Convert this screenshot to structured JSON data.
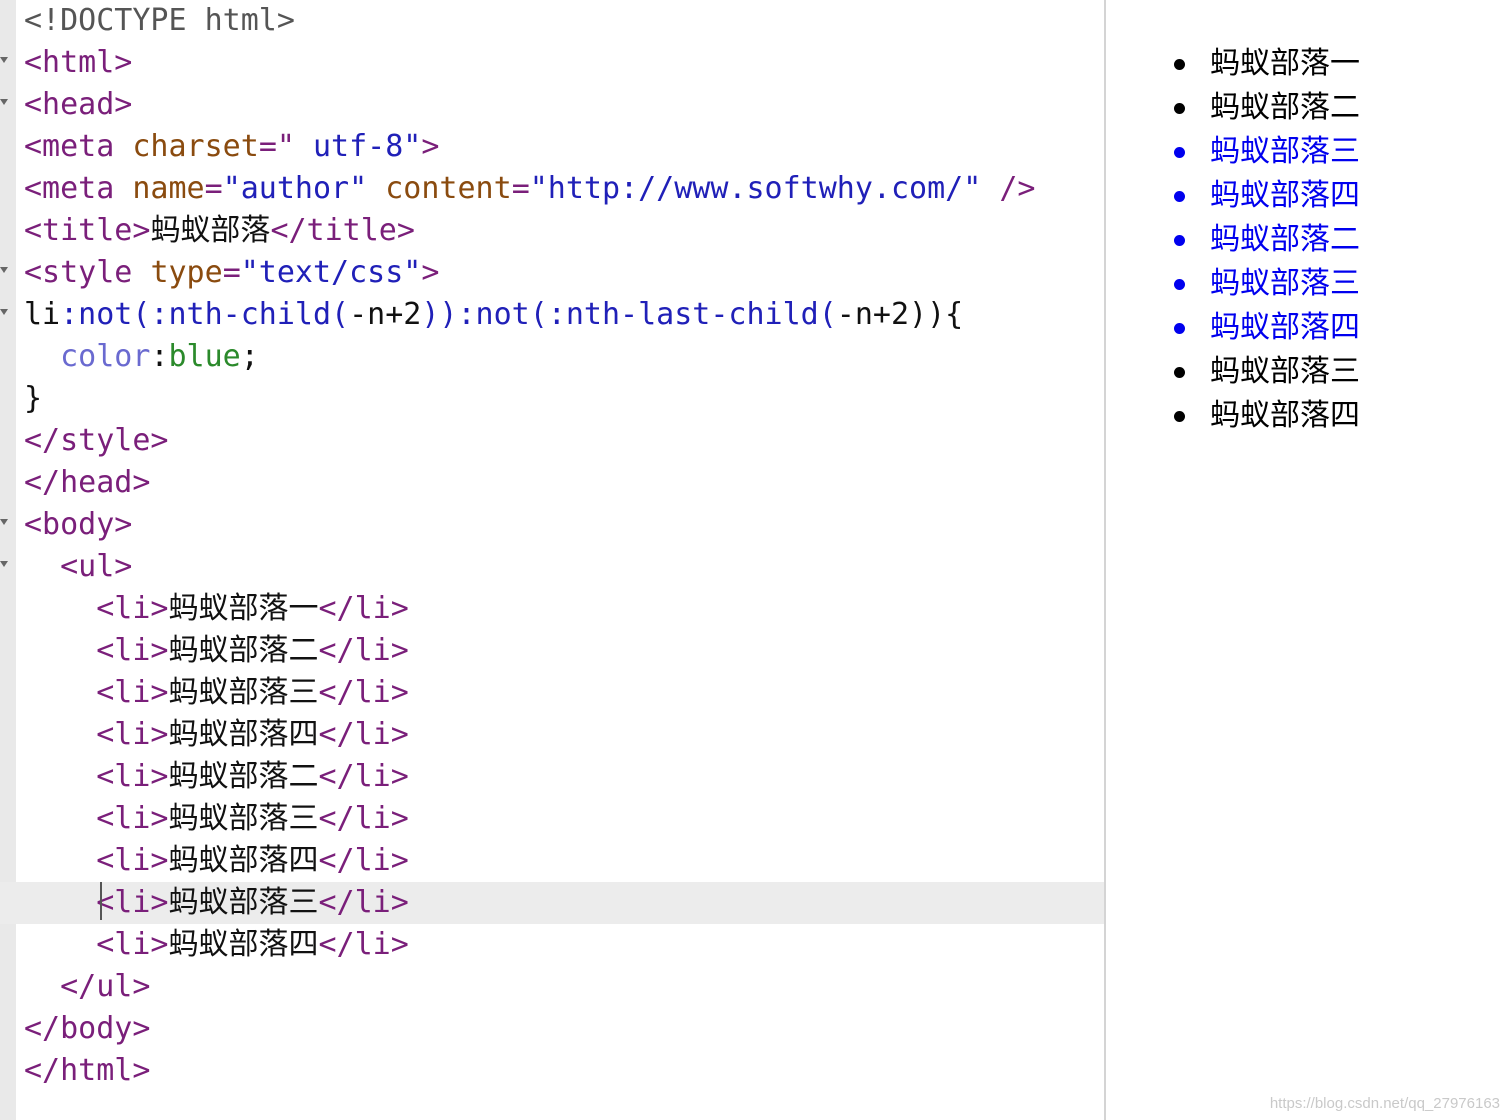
{
  "editor": {
    "lines": [
      [
        {
          "t": "<!DOCTYPE html>",
          "c": "doc"
        }
      ],
      [
        {
          "t": "<html>",
          "c": "tag"
        }
      ],
      [
        {
          "t": "<head>",
          "c": "tag"
        }
      ],
      [
        {
          "t": "<meta ",
          "c": "tag"
        },
        {
          "t": "charset",
          "c": "attr"
        },
        {
          "t": "=\" ",
          "c": "tag"
        },
        {
          "t": "utf-8\"",
          "c": "str"
        },
        {
          "t": ">",
          "c": "tag"
        }
      ],
      [
        {
          "t": "<meta ",
          "c": "tag"
        },
        {
          "t": "name",
          "c": "attr"
        },
        {
          "t": "=",
          "c": "tag"
        },
        {
          "t": "\"author\" ",
          "c": "str"
        },
        {
          "t": "content",
          "c": "attr"
        },
        {
          "t": "=",
          "c": "tag"
        },
        {
          "t": "\"http://www.softwhy.com/\"",
          "c": "str"
        },
        {
          "t": " />",
          "c": "tag"
        }
      ],
      [
        {
          "t": "<title>",
          "c": "tag"
        },
        {
          "t": "蚂蚁部落",
          "c": "text"
        },
        {
          "t": "</title>",
          "c": "tag"
        }
      ],
      [
        {
          "t": "<style ",
          "c": "tag"
        },
        {
          "t": "type",
          "c": "attr"
        },
        {
          "t": "=",
          "c": "tag"
        },
        {
          "t": "\"text/css\"",
          "c": "str"
        },
        {
          "t": ">",
          "c": "tag"
        }
      ],
      [
        {
          "t": "li",
          "c": "text"
        },
        {
          "t": ":not(:nth-child(",
          "c": "pseudo"
        },
        {
          "t": "-n+2",
          "c": "text"
        },
        {
          "t": ")):not(:nth-last-child(",
          "c": "pseudo"
        },
        {
          "t": "-n+2",
          "c": "text"
        },
        {
          "t": ")){",
          "c": "text"
        }
      ],
      [
        {
          "t": "  ",
          "c": "text"
        },
        {
          "t": "color",
          "c": "prop"
        },
        {
          "t": ":",
          "c": "text"
        },
        {
          "t": "blue",
          "c": "val"
        },
        {
          "t": ";",
          "c": "text"
        }
      ],
      [
        {
          "t": "}",
          "c": "text"
        }
      ],
      [
        {
          "t": "</style>",
          "c": "tag"
        }
      ],
      [
        {
          "t": "</head>",
          "c": "tag"
        }
      ],
      [
        {
          "t": "<body>",
          "c": "tag"
        }
      ],
      [
        {
          "t": "  ",
          "c": "text"
        },
        {
          "t": "<ul>",
          "c": "tag"
        }
      ],
      [
        {
          "t": "    ",
          "c": "text"
        },
        {
          "t": "<li>",
          "c": "tag"
        },
        {
          "t": "蚂蚁部落一",
          "c": "text"
        },
        {
          "t": "</li>",
          "c": "tag"
        }
      ],
      [
        {
          "t": "    ",
          "c": "text"
        },
        {
          "t": "<li>",
          "c": "tag"
        },
        {
          "t": "蚂蚁部落二",
          "c": "text"
        },
        {
          "t": "</li>",
          "c": "tag"
        }
      ],
      [
        {
          "t": "    ",
          "c": "text"
        },
        {
          "t": "<li>",
          "c": "tag"
        },
        {
          "t": "蚂蚁部落三",
          "c": "text"
        },
        {
          "t": "</li>",
          "c": "tag"
        }
      ],
      [
        {
          "t": "    ",
          "c": "text"
        },
        {
          "t": "<li>",
          "c": "tag"
        },
        {
          "t": "蚂蚁部落四",
          "c": "text"
        },
        {
          "t": "</li>",
          "c": "tag"
        }
      ],
      [
        {
          "t": "    ",
          "c": "text"
        },
        {
          "t": "<li>",
          "c": "tag"
        },
        {
          "t": "蚂蚁部落二",
          "c": "text"
        },
        {
          "t": "</li>",
          "c": "tag"
        }
      ],
      [
        {
          "t": "    ",
          "c": "text"
        },
        {
          "t": "<li>",
          "c": "tag"
        },
        {
          "t": "蚂蚁部落三",
          "c": "text"
        },
        {
          "t": "</li>",
          "c": "tag"
        }
      ],
      [
        {
          "t": "    ",
          "c": "text"
        },
        {
          "t": "<li>",
          "c": "tag"
        },
        {
          "t": "蚂蚁部落四",
          "c": "text"
        },
        {
          "t": "</li>",
          "c": "tag"
        }
      ],
      [
        {
          "t": "    ",
          "c": "text"
        },
        {
          "t": "<li>",
          "c": "tag"
        },
        {
          "t": "蚂蚁部落三",
          "c": "text"
        },
        {
          "t": "</li>",
          "c": "tag"
        }
      ],
      [
        {
          "t": "    ",
          "c": "text"
        },
        {
          "t": "<li>",
          "c": "tag"
        },
        {
          "t": "蚂蚁部落四",
          "c": "text"
        },
        {
          "t": "</li>",
          "c": "tag"
        }
      ],
      [
        {
          "t": "  ",
          "c": "text"
        },
        {
          "t": "</ul>",
          "c": "tag"
        }
      ],
      [
        {
          "t": "</body>",
          "c": "tag"
        }
      ],
      [
        {
          "t": "</html>",
          "c": "tag"
        }
      ]
    ],
    "folded_lines": [
      1,
      2,
      6,
      7,
      12,
      13
    ],
    "current_line": 21
  },
  "preview": {
    "items": [
      {
        "label": "蚂蚁部落一",
        "blue": false
      },
      {
        "label": "蚂蚁部落二",
        "blue": false
      },
      {
        "label": "蚂蚁部落三",
        "blue": true
      },
      {
        "label": "蚂蚁部落四",
        "blue": true
      },
      {
        "label": "蚂蚁部落二",
        "blue": true
      },
      {
        "label": "蚂蚁部落三",
        "blue": true
      },
      {
        "label": "蚂蚁部落四",
        "blue": true
      },
      {
        "label": "蚂蚁部落三",
        "blue": false
      },
      {
        "label": "蚂蚁部落四",
        "blue": false
      }
    ],
    "highlight_color": "#0000ee"
  },
  "watermark": "https://blog.csdn.net/qq_27976163"
}
